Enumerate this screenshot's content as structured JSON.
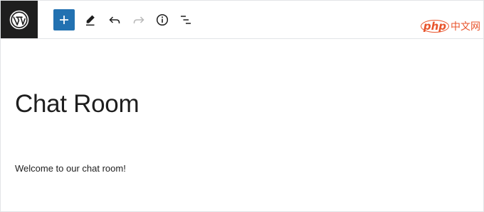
{
  "toolbar": {
    "logo_icon": "wordpress-logo-icon",
    "add_block_icon": "plus-icon",
    "tools_icon": "pencil-icon",
    "undo_icon": "undo-icon",
    "redo_icon": "redo-icon",
    "details_icon": "info-icon",
    "list_view_icon": "list-view-icon",
    "accent_color": "#2271b1",
    "logo_bg_color": "#1e1e1e"
  },
  "watermark": {
    "php": "php",
    "site": "中文网"
  },
  "post": {
    "title": "Chat Room",
    "paragraph": "Welcome to our chat room!"
  }
}
